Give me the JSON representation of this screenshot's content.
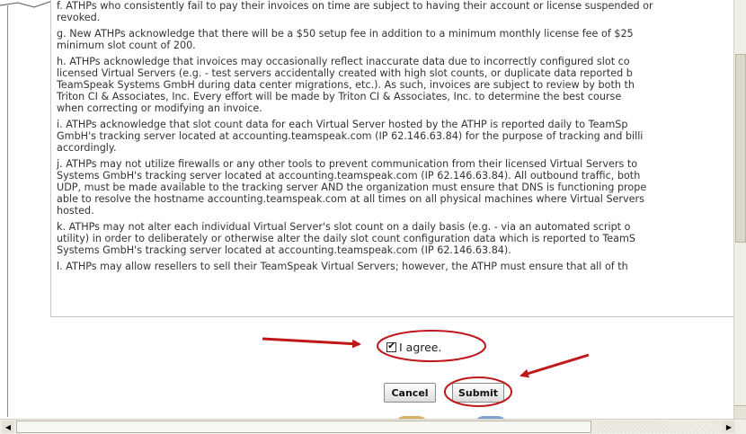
{
  "terms": [
    {
      "id": "f",
      "text": "f.  ATHPs who consistently fail to pay their invoices on time are subject to having their account or license suspended or\nrevoked."
    },
    {
      "id": "g",
      "text": "g.  New ATHPs acknowledge that there will be a $50 setup fee in addition to a minimum monthly license fee of $25\nminimum slot count of 200."
    },
    {
      "id": "h",
      "text": "h.  ATHPs acknowledge that invoices may occasionally reflect inaccurate data due to incorrectly configured slot co\nlicensed Virtual Servers (e.g. - test servers accidentally created with high slot counts, or duplicate data reported b\nTeamSpeak Systems GmbH during data center migrations, etc.). As such, invoices are subject to review by both th\nTriton CI & Associates, Inc. Every effort will be made by Triton CI & Associates, Inc. to determine the best course\nwhen correcting or modifying an invoice."
    },
    {
      "id": "i",
      "text": "i.  ATHPs acknowledge that slot count data for each Virtual Server hosted by the ATHP is reported daily to TeamSp\nGmbH's tracking server located at accounting.teamspeak.com (IP 62.146.63.84) for the purpose of tracking and billi\naccordingly."
    },
    {
      "id": "j",
      "text": "j.  ATHPs may not utilize firewalls or any other tools to prevent communication from their licensed Virtual Servers to\nSystems GmbH's tracking server located at accounting.teamspeak.com (IP 62.146.63.84). All outbound traffic, both\nUDP, must be made available to the tracking server AND the organization must ensure that DNS is functioning prope\nable to resolve the hostname accounting.teamspeak.com at all times on all physical machines where Virtual Servers\nhosted."
    },
    {
      "id": "k",
      "text": "k.  ATHPs may not alter each individual Virtual Server's slot count on a daily basis (e.g. - via an automated script o\nutility) in order to deliberately or otherwise alter the daily slot count configuration data which is reported to TeamS\nSystems GmbH's tracking server located at accounting.teamspeak.com (IP 62.146.63.84)."
    },
    {
      "id": "l",
      "text": "l.  ATHPs may allow resellers to sell their TeamSpeak Virtual Servers; however, the ATHP must ensure that all of th"
    }
  ],
  "agree": {
    "label": "I agree.",
    "checked": true,
    "check_glyph": "✔"
  },
  "buttons": {
    "cancel_label": "Cancel",
    "submit_label": "Submit"
  },
  "scrollbars": {
    "left_arrow": "◀",
    "right_arrow": "▶"
  },
  "colors": {
    "annotation_red": "#c0171b",
    "text": "#333333",
    "button_border": "#8c8c8c"
  }
}
